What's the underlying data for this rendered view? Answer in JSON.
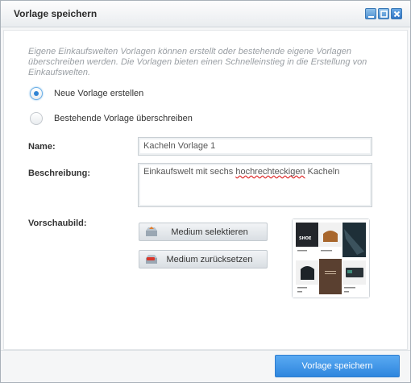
{
  "window": {
    "title": "Vorlage speichern"
  },
  "intro_text": "Eigene Einkaufswelten Vorlagen können erstellt oder bestehende eigene Vorlagen überschreiben werden. Die Vorlagen bieten einen Schnelleinstieg in die Erstellung von Einkaufswelten.",
  "options": {
    "new_label": "Neue Vorlage erstellen",
    "overwrite_label": "Bestehende Vorlage überschreiben",
    "selected": "new"
  },
  "form": {
    "name_label": "Name:",
    "name_value": "Kacheln Vorlage 1",
    "desc_label": "Beschreibung:",
    "desc_before": "Einkaufswelt mit sechs ",
    "desc_misspelled": "hochrechteckigen",
    "desc_after": " Kacheln",
    "preview_label": "Vorschaubild:"
  },
  "buttons": {
    "select_medium": "Medium selektieren",
    "reset_medium": "Medium zurücksetzen",
    "save": "Vorlage speichern"
  },
  "preview": {
    "logo_text": "SHOE"
  },
  "colors": {
    "accent": "#2e86de",
    "title_text": "#2b2b2b",
    "intro_text": "#9a9fa4"
  },
  "icons": [
    "minimize-icon",
    "maximize-icon",
    "close-icon",
    "media-select-icon",
    "media-reset-icon"
  ]
}
